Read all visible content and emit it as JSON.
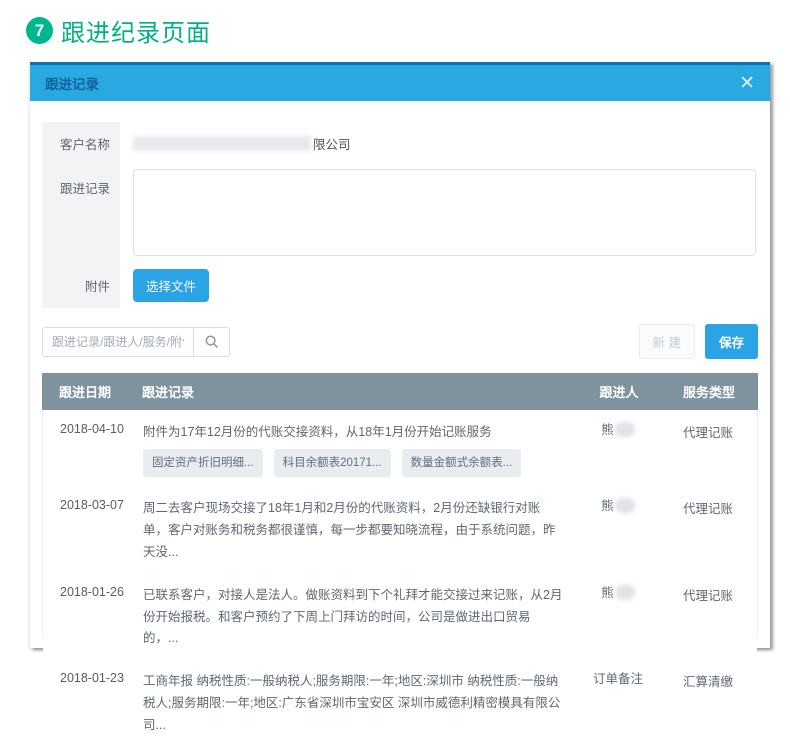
{
  "page": {
    "step_number": "7",
    "title": "跟进纪录页面",
    "accent_green": "#00b184"
  },
  "modal": {
    "title": "跟进记录",
    "close_icon": "✕",
    "header_color": "#29a9e2",
    "form": {
      "customer_label": "客户名称",
      "customer_value_visible": "限公司",
      "record_label": "跟进记录",
      "record_value": "",
      "attachment_label": "附件",
      "choose_file_button": "选择文件"
    },
    "toolbar": {
      "search_placeholder": "跟进记录/跟进人/服务/附件",
      "search_icon": "magnifier",
      "new_button": "新 建",
      "save_button": "保存",
      "button_blue": "#2ba4e5"
    },
    "table": {
      "header_color": "#7e939e",
      "headers": [
        "跟进日期",
        "跟进记录",
        "跟进人",
        "服务类型"
      ],
      "rows": [
        {
          "date": "2018-04-10",
          "record": "附件为17年12月份的代账交接资料，从18年1月份开始记账服务",
          "attachments": [
            "固定资产折旧明细...",
            "科目余额表20171...",
            "数量金额式余额表..."
          ],
          "person": "熊",
          "person_redacted": true,
          "service": "代理记账"
        },
        {
          "date": "2018-03-07",
          "record": "周二去客户现场交接了18年1月和2月份的代账资料，2月份还缺银行对账单，客户对账务和税务都很谨慎，每一步都要知晓流程，由于系统问题，昨天没...",
          "attachments": [],
          "person": "熊",
          "person_redacted": true,
          "service": "代理记账"
        },
        {
          "date": "2018-01-26",
          "record": "已联系客户，对接人是法人。做账资料到下个礼拜才能交接过来记账，从2月份开始报税。和客户预约了下周上门拜访的时间，公司是做进出口贸易的，...",
          "attachments": [],
          "person": "熊",
          "person_redacted": true,
          "service": "代理记账"
        },
        {
          "date": "2018-01-23",
          "record": "工商年报 纳税性质:一般纳税人;服务期限:一年;地区:深圳市 纳税性质:一般纳税人;服务期限:一年;地区:广东省深圳市宝安区 深圳市威德利精密模具有限公司...",
          "attachments": [],
          "person": "订单备注",
          "person_redacted": false,
          "service": "汇算清缴"
        }
      ]
    }
  }
}
